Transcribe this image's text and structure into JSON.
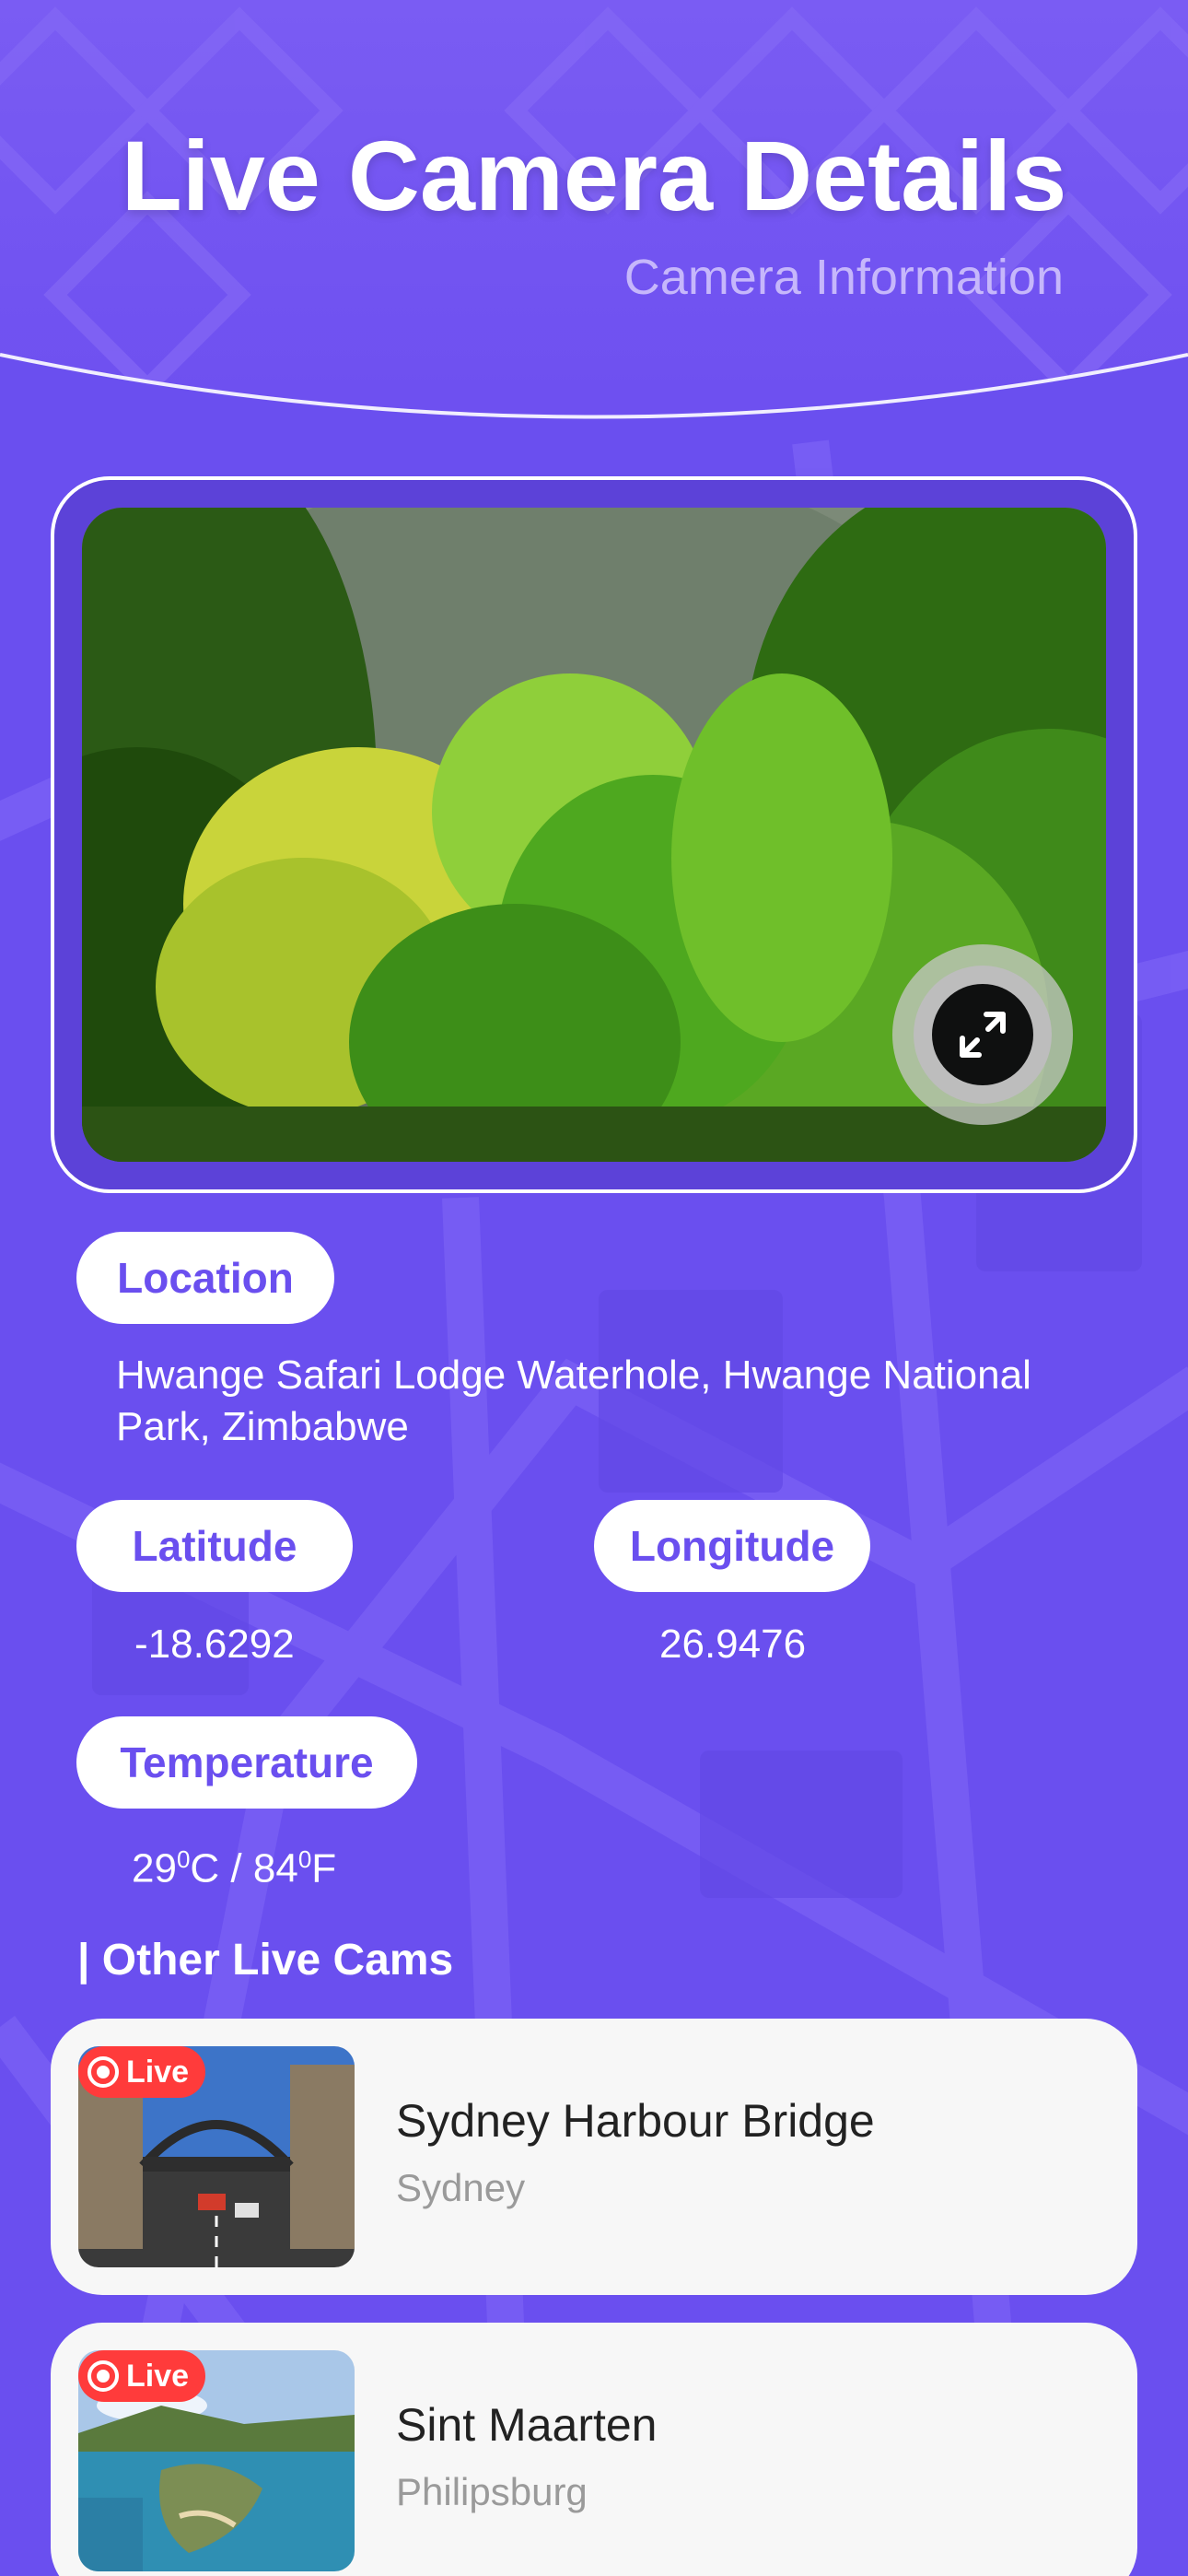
{
  "header": {
    "title": "Live Camera Details",
    "subtitle": "Camera Information"
  },
  "viewer": {
    "image_description": "forest scene",
    "expand_icon": "expand-arrows-icon"
  },
  "details": {
    "location_label": "Location",
    "location_value": "Hwange Safari Lodge Waterhole, Hwange National Park, Zimbabwe",
    "latitude_label": "Latitude",
    "latitude_value": "-18.6292",
    "longitude_label": "Longitude",
    "longitude_value": "26.9476",
    "temperature_label": "Temperature",
    "temperature_c": "29",
    "temperature_f": "84"
  },
  "other_cams": {
    "section_title": "| Other Live Cams",
    "items": [
      {
        "badge": "Live",
        "name": "Sydney Harbour Bridge",
        "city": "Sydney"
      },
      {
        "badge": "Live",
        "name": "Sint Maarten",
        "city": "Philipsburg"
      }
    ]
  },
  "colors": {
    "background": "#6a4fef",
    "pill_text": "#6a4fef",
    "live_badge": "#ff3b3b",
    "card": "#f7f7f7"
  }
}
